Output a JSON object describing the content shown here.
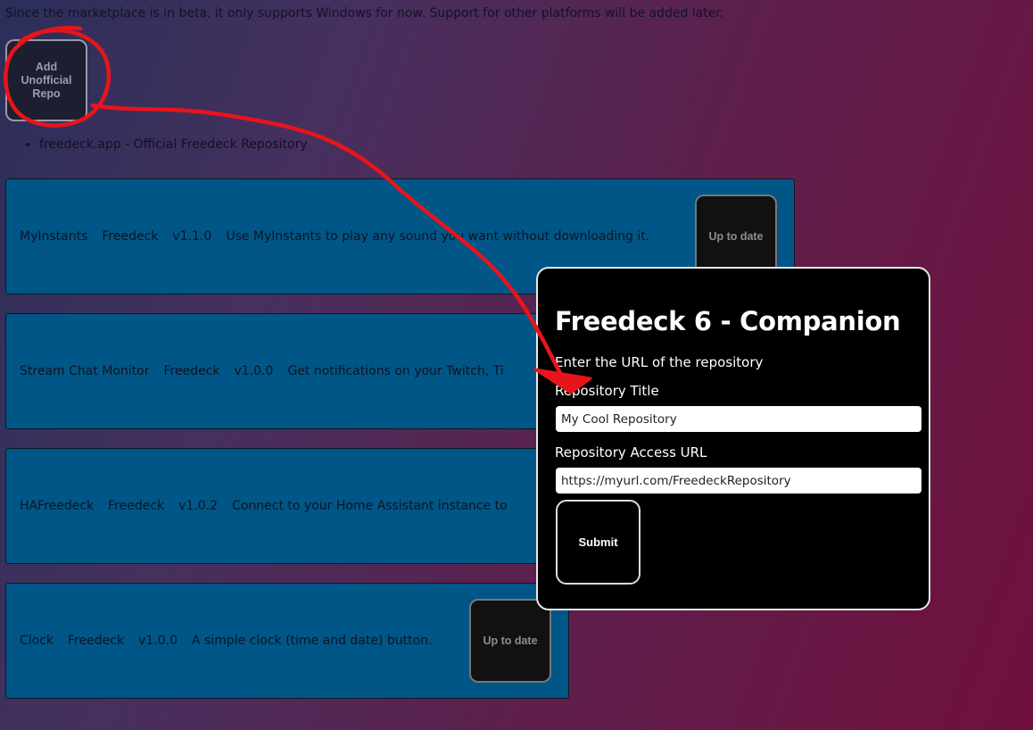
{
  "notice": "Since the marketplace is in beta, it only supports Windows for now. Support for other platforms will be added later.",
  "add_repo_button": "Add Unofficial Repo",
  "repositories": [
    "freedeck.app - Official Freedeck Repository"
  ],
  "plugins": [
    {
      "name": "MyInstants",
      "author": "Freedeck",
      "version": "v1.1.0",
      "description": "Use MyInstants to play any sound you want without downloading it.",
      "status": "Up to date"
    },
    {
      "name": "Stream Chat Monitor",
      "author": "Freedeck",
      "version": "v1.0.0",
      "description": "Get notifications on your Twitch, Ti",
      "status": ""
    },
    {
      "name": "HAFreedeck",
      "author": "Freedeck",
      "version": "v1.0.2",
      "description": "Connect to your Home Assistant instance to",
      "status": ""
    },
    {
      "name": "Clock",
      "author": "Freedeck",
      "version": "v1.0.0",
      "description": "A simple clock (time and date) button.",
      "status": "Up to date"
    }
  ],
  "modal": {
    "title": "Freedeck 6 - Companion",
    "instruction": "Enter the URL of the repository",
    "title_label": "Repository Title",
    "title_value": "My Cool Repository",
    "url_label": "Repository Access URL",
    "url_value": "https://myurl.com/FreedeckRepository",
    "submit_label": "Submit"
  },
  "colors": {
    "plugin_bg": "#005687",
    "modal_bg": "#000000",
    "annotation": "#e8141b"
  }
}
